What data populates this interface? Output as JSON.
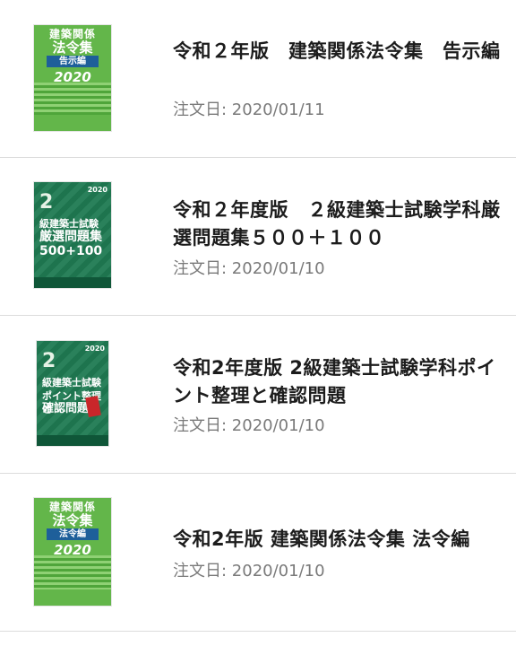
{
  "orders": [
    {
      "title": "令和２年版　建築関係法令集　告示編",
      "date_label": "注文日: 2020/01/11",
      "cover": {
        "kind": "law",
        "line1": "建築関係",
        "line2": "法令集",
        "sub": "告示編",
        "year_label": "2020",
        "publisher_icon": "book-cover-law-icon",
        "color": "#63b64a"
      }
    },
    {
      "title": "令和２年度版　２級建築士試験学科厳選問題集５００＋１００",
      "date_label": "注文日: 2020/01/10",
      "cover": {
        "kind": "exam",
        "num": "2",
        "year_label": "2020",
        "line1": "級建築士試験",
        "line2": "厳選問題集",
        "line3": "500+100",
        "color": "#1f7a52"
      }
    },
    {
      "title": "令和2年度版 2級建築士試験学科ポイント整理と確認問題",
      "date_label": "注文日: 2020/01/10",
      "cover": {
        "kind": "exam",
        "num": "2",
        "year_label": "2020",
        "line1": "級建築士試験",
        "line2": "ポイント整理と",
        "line3": "確認問題",
        "color": "#1f7a52"
      }
    },
    {
      "title": "令和2年版 建築関係法令集 法令編",
      "date_label": "注文日: 2020/01/10",
      "cover": {
        "kind": "law",
        "line1": "建築関係",
        "line2": "法令集",
        "sub": "法令編",
        "year_label": "2020",
        "publisher_icon": "book-cover-law-icon",
        "color": "#63b64a"
      }
    }
  ]
}
